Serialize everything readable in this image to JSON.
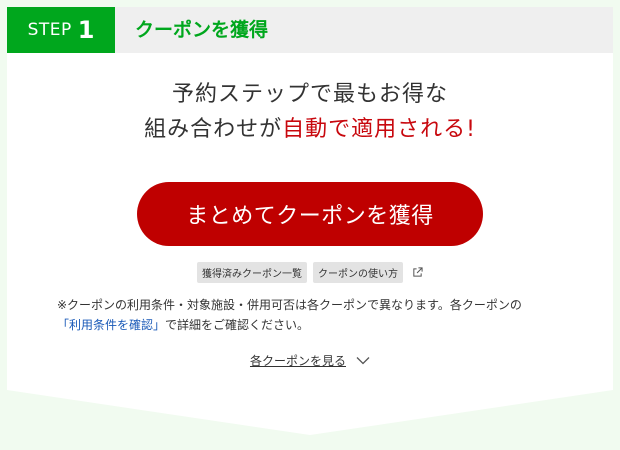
{
  "header": {
    "step_label": "STEP",
    "step_number": "1",
    "title": "クーポンを獲得"
  },
  "headline": {
    "line1": "予約ステップで最もお得な",
    "line2_prefix": "組み合わせが",
    "line2_accent": "自動で適用される!"
  },
  "cta": {
    "label": "まとめてクーポンを獲得"
  },
  "tags": {
    "acquired": "獲得済みクーポン一覧",
    "howto": "クーポンの使い方"
  },
  "note": {
    "line1": "※クーポンの利用条件・対象施設・併用可否は各クーポンで異なります。各クーポンの",
    "link": "「利用条件を確認」",
    "line2_suffix": "で詳細をご確認ください。"
  },
  "see_each": {
    "label": "各クーポンを見る"
  },
  "colors": {
    "green": "#00a71d",
    "red": "#bf0000",
    "link_blue": "#1a5ab8"
  },
  "icons": [
    "external-link-icon",
    "chevron-down-icon"
  ]
}
